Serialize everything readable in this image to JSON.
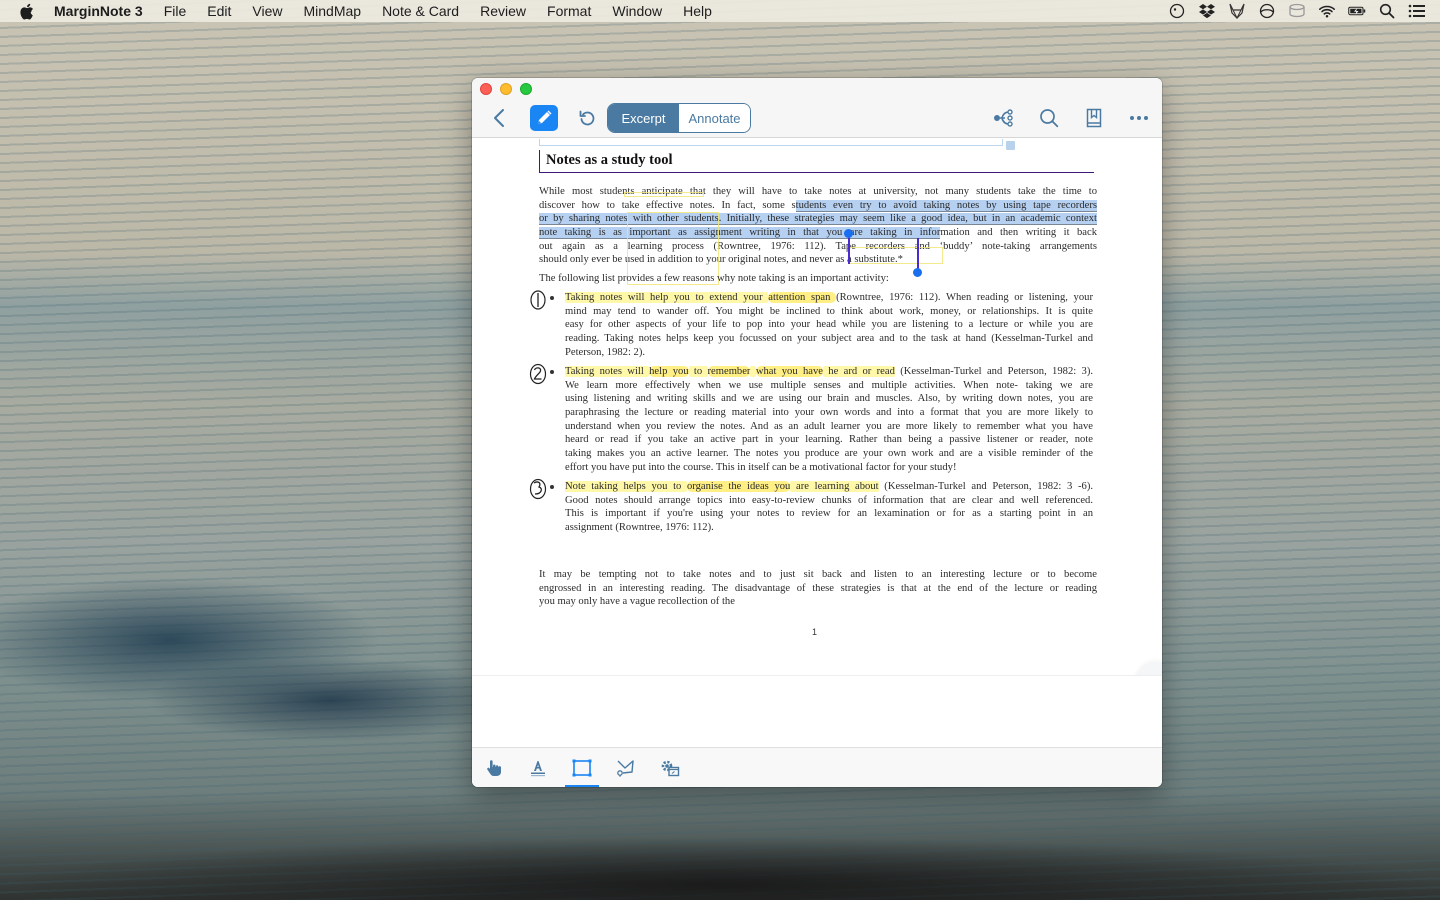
{
  "menubar": {
    "apple": "apple-menu",
    "items": [
      "MarginNote 3",
      "File",
      "Edit",
      "View",
      "MindMap",
      "Note & Card",
      "Review",
      "Format",
      "Window",
      "Help"
    ],
    "status_icons": [
      "time-machine-icon",
      "dropbox-icon",
      "gitlab-fox-icon",
      "sync-icon",
      "database-icon",
      "wifi-icon",
      "battery-charging-icon",
      "spotlight-search-icon",
      "notification-center-icon"
    ]
  },
  "window": {
    "toolbar": {
      "back": "back",
      "pen": "pen",
      "undo": "undo",
      "mode_tabs": [
        {
          "label": "Excerpt",
          "active": true
        },
        {
          "label": "Annotate",
          "active": false
        }
      ],
      "right_icons": [
        "mindmap",
        "search",
        "bookmark",
        "more"
      ]
    },
    "document": {
      "section_title": "Notes as a study tool",
      "paragraph1": [
        {
          "segments": [
            {
              "t": "While most students anticipate that they will have to take notes at university, not many students take the time to"
            }
          ]
        },
        {
          "segments": [
            {
              "t": "discover how to take effective notes. In fact, some s"
            },
            {
              "t": "tudents even try to avoid taking notes by using tape recorders",
              "sel": true
            }
          ]
        },
        {
          "segments": [
            {
              "t": "or by sharing notes with other students. Initially, these strategies may seem like a good idea, but in an academic  context",
              "sel": true
            }
          ]
        },
        {
          "segments": [
            {
              "t": "note taking is as important as assignment writing in that you are taking in infor",
              "sel": true
            },
            {
              "t": "mation and then writing it back"
            }
          ]
        },
        {
          "segments": [
            {
              "t": "out again as a learning process (Rowntree, 1976: 112). Tape recorders and ‘buddy’ note-taking arrangements"
            }
          ]
        },
        {
          "segments": [
            {
              "t": "should only ever be used in addition to your original notes, and never as a substitute.*"
            }
          ],
          "last": true
        }
      ],
      "paragraph2": "The following list provides a few reasons why note taking is an important activity:",
      "list_items": [
        {
          "handwritten_number": "1",
          "lines": [
            [
              {
                "t": "Taking notes will help you to extend your ",
                "hl": true
              },
              {
                "t": "attention span ",
                "hl2": true
              },
              {
                "t": "(Rowntree, 1976: 112). When reading or listening, your"
              }
            ],
            [
              {
                "t": "mind may tend to wander off. You might be inclined to think about work, money, or relationships. It is quite"
              }
            ],
            [
              {
                "t": "easy for other aspects of your life to pop into your head while you are listening to a lecture or while you are"
              }
            ],
            [
              {
                "t": "reading. Taking notes helps keep you focussed on your subject area and to the task at hand (Kesselman-Turkel and"
              }
            ],
            [
              {
                "t": "Peterson, 1982: 2)."
              }
            ]
          ]
        },
        {
          "handwritten_number": "2",
          "lines": [
            [
              {
                "t": "Taking notes will ",
                "hl": true
              },
              {
                "t": "help you",
                "hl2": true
              },
              {
                "t": " to ",
                "hl": true
              },
              {
                "t": "remember",
                "hl2": true
              },
              {
                "t": " ",
                "hl": true
              },
              {
                "t": "what you have",
                "hl2": true
              },
              {
                "t": " he ard or read",
                "hl": true
              },
              {
                "t": " (Kesselman-Turkel and Peterson, 1982: 3)."
              }
            ],
            [
              {
                "t": "We learn more effectively when we use multiple senses and multiple activities. When note- taking we are"
              }
            ],
            [
              {
                "t": "using listening and writing skills and we are using our brain and muscles. Also, by writing down notes, you are"
              }
            ],
            [
              {
                "t": "paraphrasing the lecture or reading material into your own words and into a format that you are more likely to"
              }
            ],
            [
              {
                "t": "understand when you review the notes. And as an adult learner you are more likely to remember what you have"
              }
            ],
            [
              {
                "t": "heard or read if you take an active part in your learning. Rather than being a passive listener or reader, note"
              }
            ],
            [
              {
                "t": "taking makes you an active learner. The notes you produce are your own work and are a visible reminder of the"
              }
            ],
            [
              {
                "t": "effort you have put into the course. This in itself can be a motivational factor for your study!"
              }
            ]
          ]
        },
        {
          "handwritten_number": "3",
          "lines": [
            [
              {
                "t": "Note taking helps you to ",
                "hl": true
              },
              {
                "t": "organise the ideas you",
                "hl2": true
              },
              {
                "t": " are learning about",
                "hl": true
              },
              {
                "t": " (Kesselman-Turkel and Peterson, 1982: 3 -6)."
              }
            ],
            [
              {
                "t": "Good notes should arrange topics into easy-to-review chunks of information that are clear and well referenced."
              }
            ],
            [
              {
                "t": "This is important if you're using your notes to review for an lexamination or for as a starting point in an"
              }
            ],
            [
              {
                "t": "assignment (Rowntree, 1976: 112)."
              }
            ]
          ]
        }
      ],
      "paragraph3": [
        "It may be tempting not to take notes and to just sit back and listen to an interesting lecture or to become",
        "engrossed in an interesting reading. The disadvantage of these strategies is that at the end of the lecture or reading",
        "you may only have a vague recollection of the"
      ],
      "page_number": "1"
    },
    "bottom_tools": [
      {
        "name": "hand-tool",
        "active": false
      },
      {
        "name": "text-highlight-tool",
        "active": false
      },
      {
        "name": "rectangle-select-tool",
        "active": true
      },
      {
        "name": "lasso-tool",
        "active": false
      },
      {
        "name": "tool-settings",
        "active": false
      }
    ]
  },
  "colors": {
    "accent": "#1a86f4",
    "segment_active": "#4a7aa2",
    "selection": "#78aae6",
    "highlight": "#fff58c",
    "handle": "#4b2bd1"
  }
}
